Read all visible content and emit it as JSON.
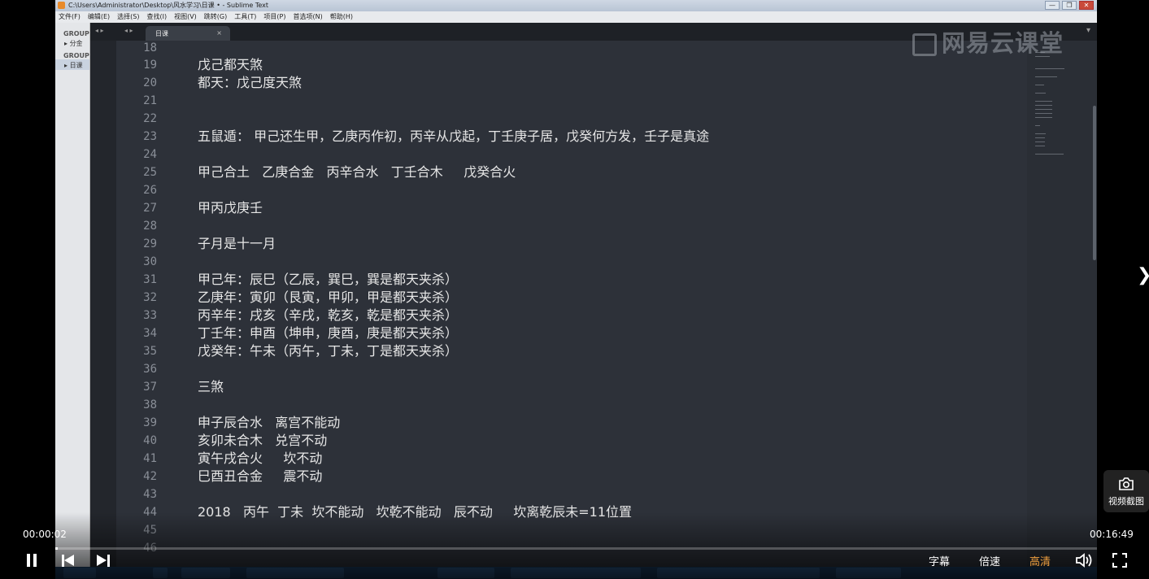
{
  "window": {
    "title": "C:\\Users\\Administrator\\Desktop\\风水学习\\日课 • - Sublime Text",
    "controls": [
      "—",
      "❐",
      "✕"
    ]
  },
  "menu": [
    "文件(F)",
    "编辑(E)",
    "选择(S)",
    "查找(I)",
    "视图(V)",
    "跳转(G)",
    "工具(T)",
    "项目(P)",
    "首选项(N)",
    "帮助(H)"
  ],
  "sidebar": {
    "groups": [
      {
        "label": "GROUP",
        "items": [
          "分金"
        ]
      },
      {
        "label": "GROUP",
        "items": [
          "日课"
        ]
      }
    ]
  },
  "tab": {
    "label": "日课",
    "close": "×",
    "nav": "◂ ▸",
    "dropdown": "▾"
  },
  "watermark": "网易云课堂",
  "editor": {
    "lines": [
      {
        "n": "18",
        "text": ""
      },
      {
        "n": "19",
        "text": "戊己都天煞"
      },
      {
        "n": "20",
        "text": "都天：戊己度天煞"
      },
      {
        "n": "21",
        "text": ""
      },
      {
        "n": "22",
        "text": ""
      },
      {
        "n": "23",
        "text": "五鼠遁： 甲己还生甲，乙庚丙作初，丙辛从戊起，丁壬庚子居，戊癸何方发，壬子是真途"
      },
      {
        "n": "24",
        "text": ""
      },
      {
        "n": "25",
        "text": "甲己合土   乙庚合金   丙辛合水   丁壬合木     戊癸合火"
      },
      {
        "n": "26",
        "text": ""
      },
      {
        "n": "27",
        "text": "甲丙戊庚壬"
      },
      {
        "n": "28",
        "text": ""
      },
      {
        "n": "29",
        "text": "子月是十一月"
      },
      {
        "n": "30",
        "text": ""
      },
      {
        "n": "31",
        "text": "甲己年：辰巳（乙辰，巽巳，巽是都天夹杀）"
      },
      {
        "n": "32",
        "text": "乙庚年：寅卯（艮寅，甲卯，甲是都天夹杀）"
      },
      {
        "n": "33",
        "text": "丙辛年：戌亥（辛戌，乾亥，乾是都天夹杀）"
      },
      {
        "n": "34",
        "text": "丁壬年：申酉（坤申，庚酉，庚是都天夹杀）"
      },
      {
        "n": "35",
        "text": "戊癸年：午未（丙午，丁未，丁是都天夹杀）"
      },
      {
        "n": "36",
        "text": ""
      },
      {
        "n": "37",
        "text": "三煞"
      },
      {
        "n": "38",
        "text": ""
      },
      {
        "n": "39",
        "text": "申子辰合水   离宫不能动"
      },
      {
        "n": "40",
        "text": "亥卯未合木   兑宫不动"
      },
      {
        "n": "41",
        "text": "寅午戌合火     坎不动"
      },
      {
        "n": "42",
        "text": "巳酉丑合金     震不动"
      },
      {
        "n": "43",
        "text": ""
      },
      {
        "n": "44",
        "text": "2018   丙午  丁未  坎不能动   坎乾不能动   辰不动     坎离乾辰未=11位置"
      },
      {
        "n": "45",
        "text": ""
      },
      {
        "n": "46",
        "text": ""
      }
    ]
  },
  "player": {
    "time_current": "00:00:02",
    "time_total": "00:16:49",
    "progress": 0.002,
    "subtitle_label": "字幕",
    "speed_label": "倍速",
    "quality_label": "高清",
    "screenshot_label": "视频截图",
    "next_arrow": "❯",
    "quality_color": "#f0a040"
  }
}
